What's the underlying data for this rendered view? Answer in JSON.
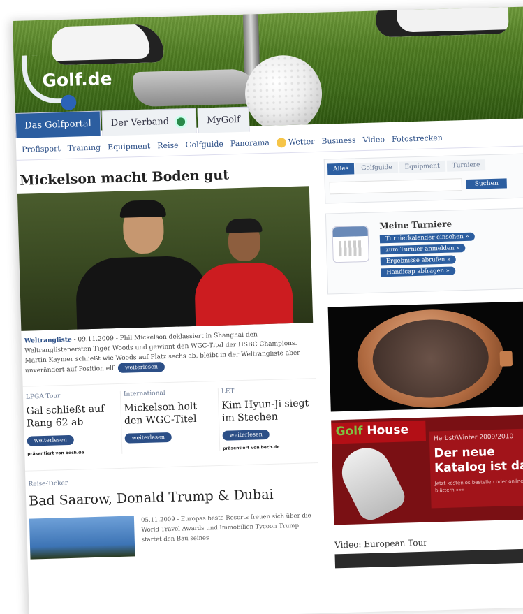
{
  "header": {
    "logo": "Golf.de"
  },
  "tabs": [
    {
      "label": "Das Golfportal",
      "active": true
    },
    {
      "label": "Der Verband"
    },
    {
      "label": "MyGolf"
    }
  ],
  "subnav": [
    "Profisport",
    "Training",
    "Equipment",
    "Reise",
    "Golfguide",
    "Panorama",
    "Wetter",
    "Business",
    "Video",
    "Fotostrecken"
  ],
  "main_story": {
    "headline": "Mickelson macht Boden gut",
    "category": "Weltrangliste",
    "date": "09.11.2009",
    "text": "Phil Mickelson deklassiert in Shanghai den Weltranglistenersten Tiger Woods und gewinnt den WGC-Titel der HSBC Champions. Martin Kaymer schließt wie Woods auf Platz sechs ab, bleibt in der Weltrangliste aber unverändert auf Position elf.",
    "more": "weiterlesen"
  },
  "teasers": [
    {
      "kicker": "LPGA Tour",
      "title": "Gal schließt auf Rang 62 ab",
      "more": "weiterlesen",
      "sponsor_prefix": "präsentiert von",
      "sponsor": "bech.de"
    },
    {
      "kicker": "International",
      "title": "Mickelson holt den WGC-Titel",
      "more": "weiterlesen"
    },
    {
      "kicker": "LET",
      "title": "Kim Hyun-Ji siegt im Stechen",
      "more": "weiterlesen",
      "sponsor_prefix": "präsentiert von",
      "sponsor": "bech.de"
    }
  ],
  "ticker": {
    "kicker": "Reise-Ticker",
    "title": "Bad Saarow, Donald Trump & Dubai",
    "text": "05.11.2009 - Europas beste Resorts freuen sich über die World Travel Awards und Immobilien-Tycoon Trump startet den Bau seines"
  },
  "search": {
    "tabs": [
      "Alles",
      "Golfguide",
      "Equipment",
      "Turniere"
    ],
    "button": "Suchen"
  },
  "turniere": {
    "title": "Meine Turniere",
    "links": [
      "Turnierkalender einsehen »",
      "zum Turnier anmelden »",
      "Ergebnisse abrufen »",
      "Handicap abfragen »"
    ]
  },
  "golfhouse_ad": {
    "brand_a": "Golf",
    "brand_b": "House",
    "season": "Herbst/Winter 2009/2010",
    "headline": "Der neue Katalog ist da!",
    "small": "Jetzt kostenlos bestellen oder online blättern »»»"
  },
  "video_box": {
    "title": "Video: European Tour"
  },
  "colors": {
    "accent": "#2c5ea0",
    "brand_red": "#b30f16"
  }
}
